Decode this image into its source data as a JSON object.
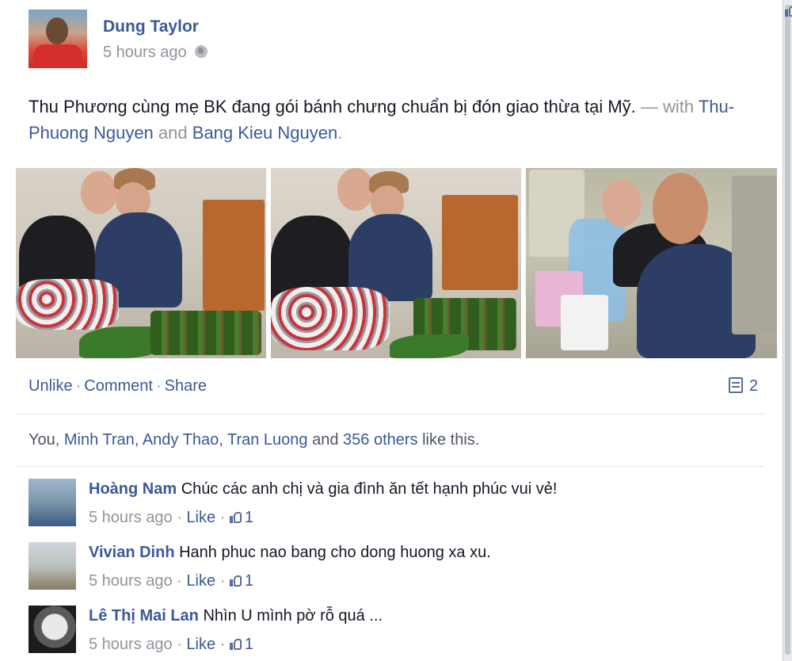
{
  "post": {
    "author": "Dung Taylor",
    "timestamp": "5 hours ago",
    "privacy_icon": "globe-icon",
    "message": {
      "text": "Thu Phương cùng mẹ BK đang gói bánh chưng chuẩn bị đón giao thừa tại Mỹ.",
      "with_sep": "— with",
      "tag1": "Thu-Phuong Nguyen",
      "and": "and",
      "tag2": "Bang Kieu Nguyen",
      "end": "."
    }
  },
  "actions": {
    "unlike": "Unlike",
    "comment": "Comment",
    "share": "Share",
    "comment_count": "2",
    "comment_icon": "comment-icon"
  },
  "likes": {
    "you": "You",
    "name1": "Minh Tran",
    "name2": "Andy Thao",
    "name3": "Tran Luong",
    "and": "and",
    "others": "356 others",
    "suffix": "like this."
  },
  "comments": [
    {
      "name": "Hoàng Nam",
      "text": "Chúc các anh chị và gia đình ăn tết hạnh phúc vui vẻ!",
      "time": "5 hours ago",
      "like": "Like",
      "count": "1"
    },
    {
      "name": "Vivian Dinh",
      "text": "Hanh phuc nao bang cho dong huong xa xu.",
      "time": "5 hours ago",
      "like": "Like",
      "count": "1"
    },
    {
      "name": "Lê Thị Mai Lan",
      "text": "Nhìn U mình pờ rỗ quá ...",
      "time": "5 hours ago",
      "like": "Like",
      "count": "1"
    }
  ],
  "colors": {
    "link": "#3b5998",
    "muted": "#90949c",
    "text": "#141823",
    "background": "#e9ebee"
  }
}
